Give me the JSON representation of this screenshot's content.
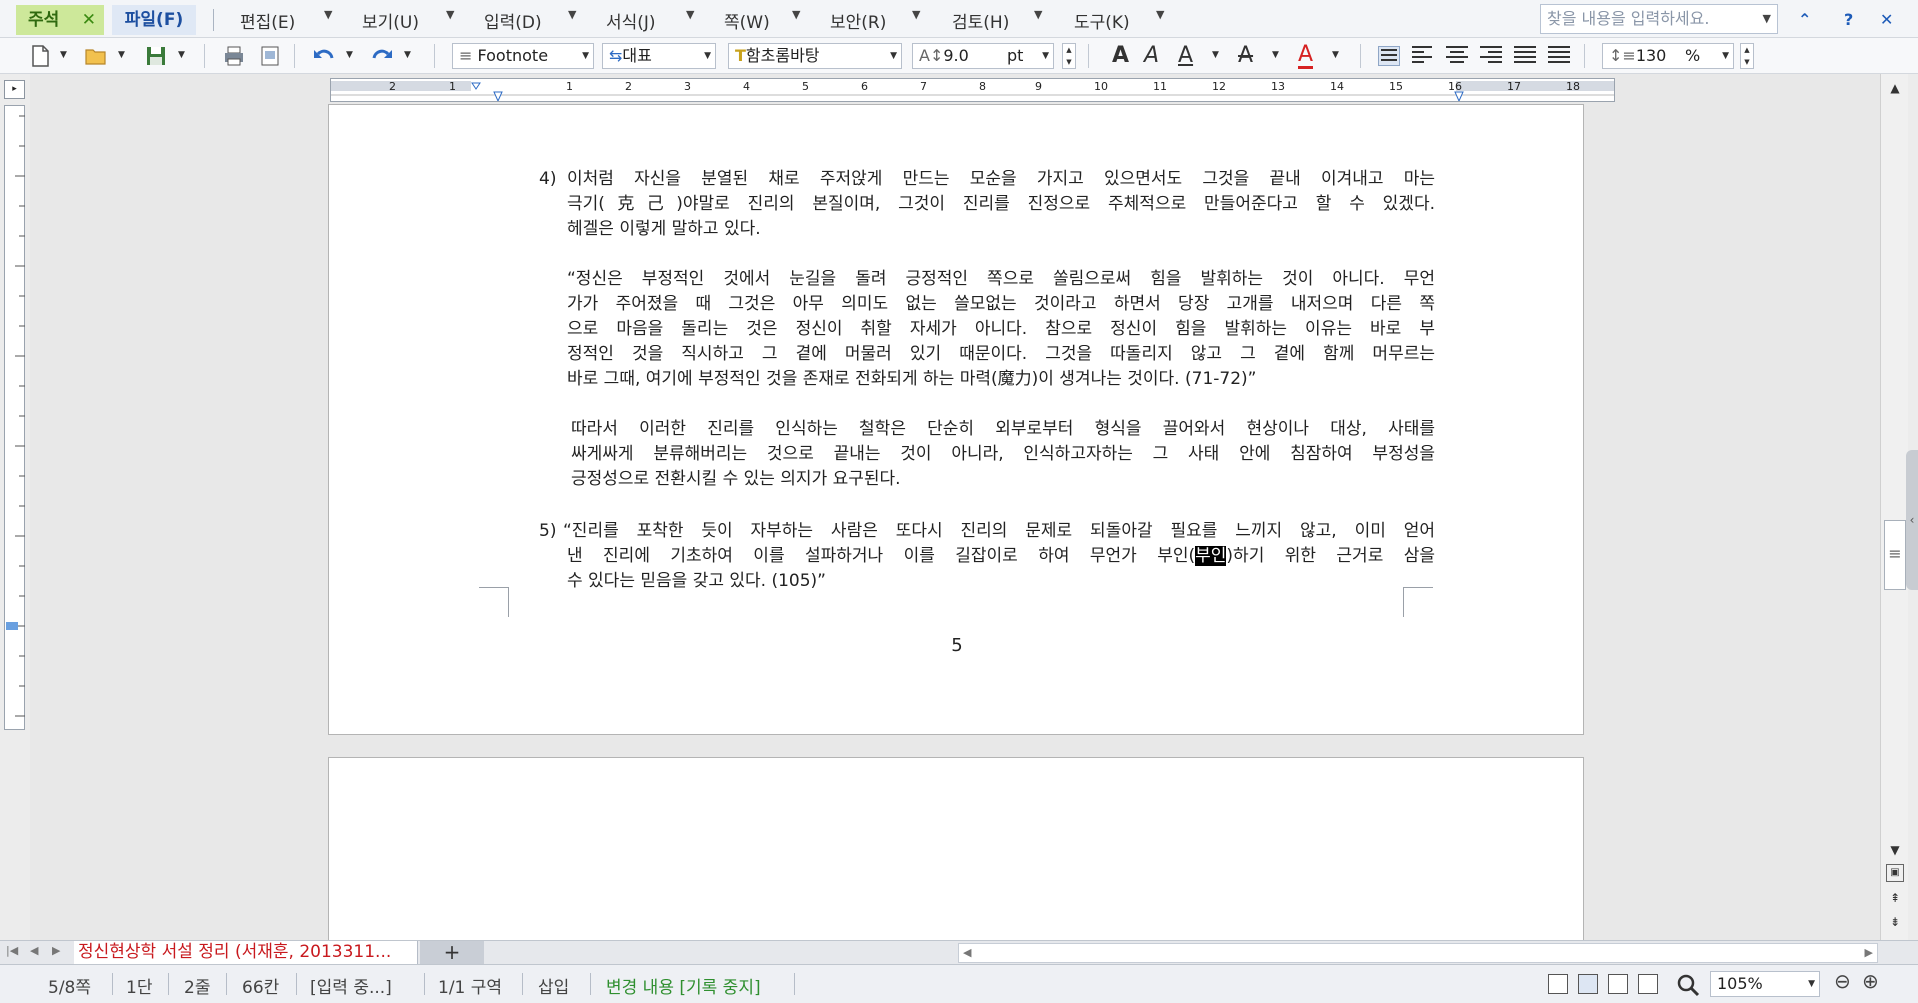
{
  "menu": {
    "memo_tab": "주석",
    "file_tab": "파일(F)",
    "items": [
      "편집(E)",
      "보기(U)",
      "입력(D)",
      "서식(J)",
      "쪽(W)",
      "보안(R)",
      "검토(H)",
      "도구(K)"
    ]
  },
  "search": {
    "placeholder": "찾을 내용을 입력하세요."
  },
  "toolbar": {
    "style": "Footnote",
    "language": "대표",
    "font": "함초롬바탕",
    "size": "9.0",
    "size_unit": "pt",
    "line_spacing": "130",
    "line_spacing_unit": "%"
  },
  "ruler": {
    "h_numbers": [
      "2",
      "1",
      "1",
      "2",
      "3",
      "4",
      "5",
      "6",
      "7",
      "8",
      "9",
      "10",
      "11",
      "12",
      "13",
      "14",
      "15",
      "16",
      "17",
      "18"
    ]
  },
  "document": {
    "footnotes": [
      {
        "num": "4)",
        "paragraphs": [
          [
            "이처럼 자신을 분열된 채로 주저앉게 만드는 모순을 가지고 있으면서도 그것을 끝내 이겨내고 마는",
            "극기(克己)야말로 진리의 본질이며, 그것이 진리를 진정으로 주체적으로 만들어준다고 할 수 있겠다.",
            "헤겔은 이렇게 말하고 있다."
          ],
          [
            "“정신은 부정적인 것에서 눈길을 돌려 긍정적인 쪽으로 쏠림으로써 힘을 발휘하는 것이 아니다. 무언",
            "가가 주어졌을 때 그것은 아무 의미도 없는 쓸모없는 것이라고 하면서 당장 고개를 내저으며 다른 쪽",
            "으로 마음을 돌리는 것은 정신이 취할 자세가 아니다. 참으로 정신이 힘을 발휘하는 이유는 바로 부",
            "정적인 것을 직시하고 그 곁에 머물러 있기 때문이다. 그것을 따돌리지 않고 그 곁에 함께 머무르는",
            "바로 그때, 여기에 부정적인 것을 존재로 전화되게 하는 마력(魔力)이 생겨나는 것이다. (71-72)”"
          ],
          [
            "따라서 이러한 진리를 인식하는 철학은 단순히 외부로부터 형식을 끌어와서 현상이나 대상, 사태를",
            "싸게싸게 분류해버리는 것으로 끝내는 것이 아니라, 인식하고자하는 그 사태 안에 침잠하여 부정성을",
            "긍정성으로 전환시킬 수 있는 의지가 요구된다."
          ]
        ]
      },
      {
        "num": "5)",
        "line1": "“진리를 포착한 듯이 자부하는 사람은 또다시 진리의 문제로 되돌아갈 필요를 느끼지 않고, 이미 얻어",
        "line2_pre": "낸 진리에 기초하여 이를 설파하거나 이를 길잡이로 하여 무언가 부인(",
        "line2_sel": "부인",
        "line2_post": ")하기 위한 근거로 삼을",
        "line3": "수 있다는 믿음을 갖고 있다. (105)”"
      }
    ],
    "page_number": "5"
  },
  "tabs": {
    "doc_tab": "정신현상학 서설 정리 (서재훈, 2013311...",
    "add": "+"
  },
  "status": {
    "page": "5/8쪽",
    "column": "1단",
    "line": "2줄",
    "char": "66칸",
    "mode": "[입력 중...]",
    "section": "1/1 구역",
    "insert": "삽입",
    "track": "변경 내용 [기록 중지]",
    "zoom": "105%"
  },
  "colors": {
    "accent": "#1d4fa0",
    "memo_bg": "#cde89a",
    "doc_tab_text": "#c8191e",
    "track_green": "#2f8f2f"
  }
}
